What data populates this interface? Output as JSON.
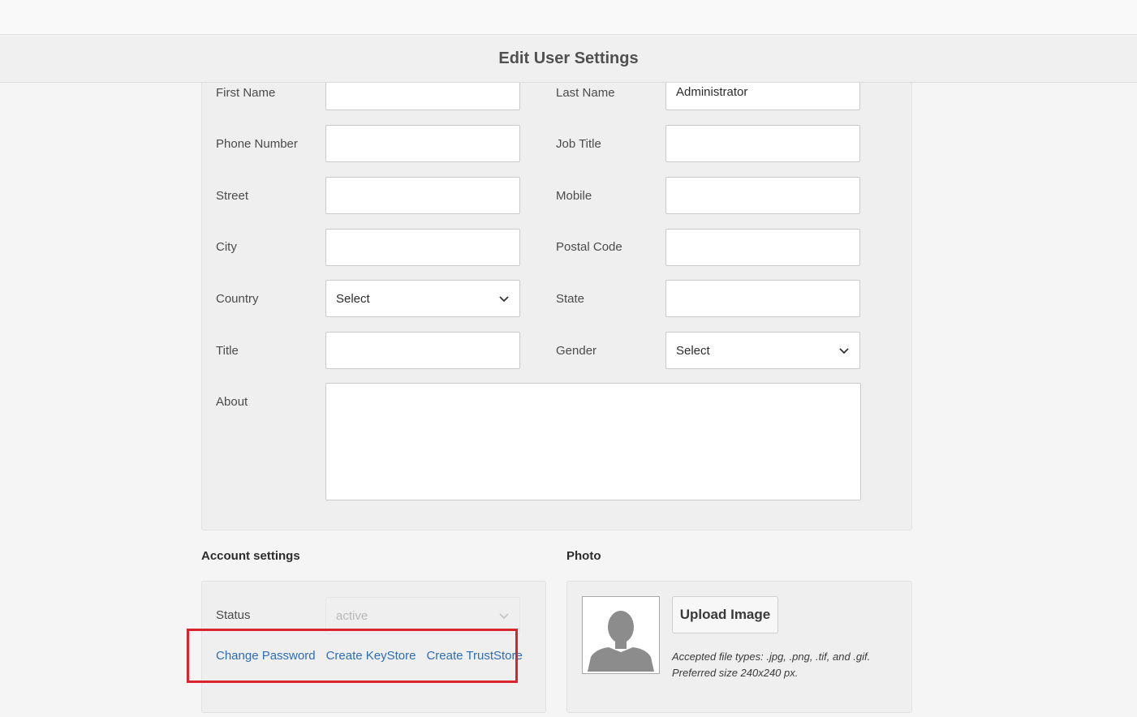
{
  "header": {
    "title": "Edit User Settings"
  },
  "form": {
    "first_name": {
      "label": "First Name",
      "value": ""
    },
    "last_name": {
      "label": "Last Name",
      "value": "Administrator"
    },
    "phone_number": {
      "label": "Phone Number",
      "value": ""
    },
    "job_title": {
      "label": "Job Title",
      "value": ""
    },
    "street": {
      "label": "Street",
      "value": ""
    },
    "mobile": {
      "label": "Mobile",
      "value": ""
    },
    "city": {
      "label": "City",
      "value": ""
    },
    "postal_code": {
      "label": "Postal Code",
      "value": ""
    },
    "country": {
      "label": "Country",
      "value": "Select"
    },
    "state": {
      "label": "State",
      "value": ""
    },
    "title": {
      "label": "Title",
      "value": ""
    },
    "gender": {
      "label": "Gender",
      "value": "Select"
    },
    "about": {
      "label": "About",
      "value": ""
    }
  },
  "account": {
    "section_title": "Account settings",
    "status_label": "Status",
    "status_value": "active",
    "links": {
      "change_password": "Change Password",
      "create_keystore": "Create KeyStore",
      "create_truststore": "Create TrustStore"
    }
  },
  "photo": {
    "section_title": "Photo",
    "upload_label": "Upload Image",
    "hint_types": "Accepted file types: .jpg, .png, .tif, and .gif.",
    "hint_size": "Preferred size 240x240 px."
  },
  "icons": {
    "dropdown": "chevron-down-icon",
    "avatar": "user-silhouette-icon"
  },
  "colors": {
    "link": "#2d6db5",
    "highlight": "#d7242d"
  }
}
